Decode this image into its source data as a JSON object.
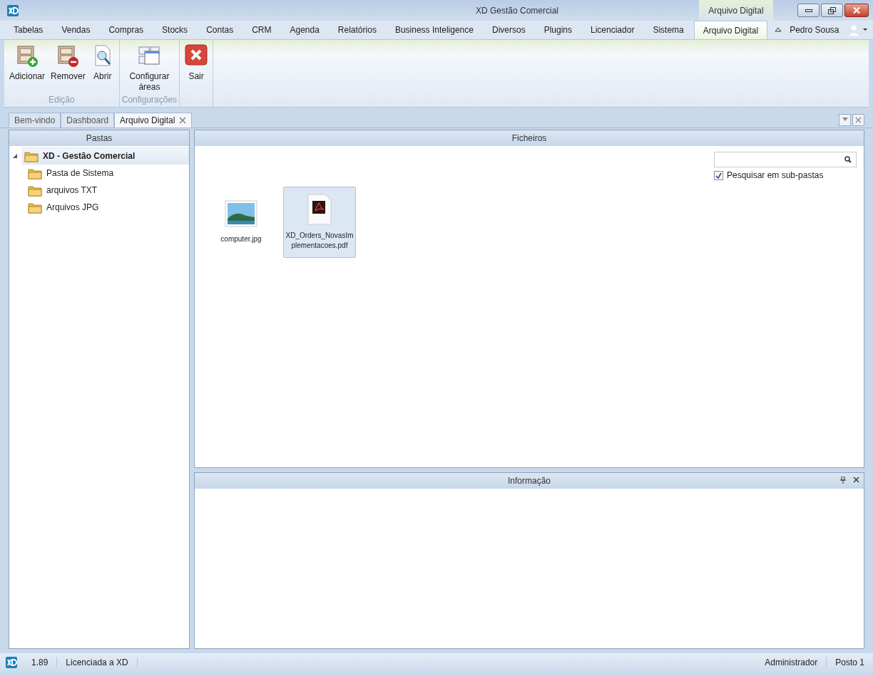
{
  "window": {
    "title": "XD Gestão Comercial",
    "context_tab": "Arquivo Digital"
  },
  "ribbon_tabs": [
    {
      "label": "Tabelas",
      "selected": false
    },
    {
      "label": "Vendas",
      "selected": false
    },
    {
      "label": "Compras",
      "selected": false
    },
    {
      "label": "Stocks",
      "selected": false
    },
    {
      "label": "Contas",
      "selected": false
    },
    {
      "label": "CRM",
      "selected": false
    },
    {
      "label": "Agenda",
      "selected": false
    },
    {
      "label": "Relatórios",
      "selected": false
    },
    {
      "label": "Business Inteligence",
      "selected": false
    },
    {
      "label": "Diversos",
      "selected": false
    },
    {
      "label": "Plugins",
      "selected": false
    },
    {
      "label": "Licenciador",
      "selected": false
    },
    {
      "label": "Sistema",
      "selected": false
    },
    {
      "label": "Arquivo Digital",
      "selected": true
    }
  ],
  "user": {
    "name": "Pedro Sousa"
  },
  "ribbon_groups": [
    {
      "label": "Edição",
      "buttons": [
        {
          "label": "Adicionar",
          "kind": "add"
        },
        {
          "label": "Remover",
          "kind": "remove"
        },
        {
          "label": "Abrir",
          "kind": "open"
        }
      ]
    },
    {
      "label": "Configurações",
      "buttons": [
        {
          "label": "Configurar áreas",
          "kind": "config"
        }
      ]
    },
    {
      "buttons": [
        {
          "label": "Sair",
          "kind": "exit"
        }
      ]
    }
  ],
  "document_tabs": [
    {
      "label": "Bem-vindo",
      "selected": false,
      "closable": false
    },
    {
      "label": "Dashboard",
      "selected": false,
      "closable": false
    },
    {
      "label": "Arquivo Digital",
      "selected": true,
      "closable": true
    }
  ],
  "folders_panel": {
    "title": "Pastas",
    "tree": [
      {
        "label": "XD - Gestão Comercial",
        "expanded": true,
        "selected": true,
        "children": [
          {
            "label": "Pasta de Sistema",
            "selected": false
          },
          {
            "label": "arquivos TXT",
            "selected": false
          },
          {
            "label": "Arquivos JPG",
            "selected": false
          }
        ]
      }
    ]
  },
  "files_panel": {
    "title": "Ficheiros",
    "search": {
      "checkbox_label": "Pesquisar em sub-pastas",
      "checked": true
    },
    "files": [
      {
        "name": "computer.jpg",
        "kind": "image",
        "selected": false
      },
      {
        "name": "XD_Orders_NovasImplementacoes.pdf",
        "kind": "pdf",
        "selected": true
      }
    ]
  },
  "info_panel": {
    "title": "Informação"
  },
  "status_bar": {
    "version": "1.89",
    "license": "Licenciada a XD",
    "role": "Administrador",
    "station": "Posto 1"
  }
}
